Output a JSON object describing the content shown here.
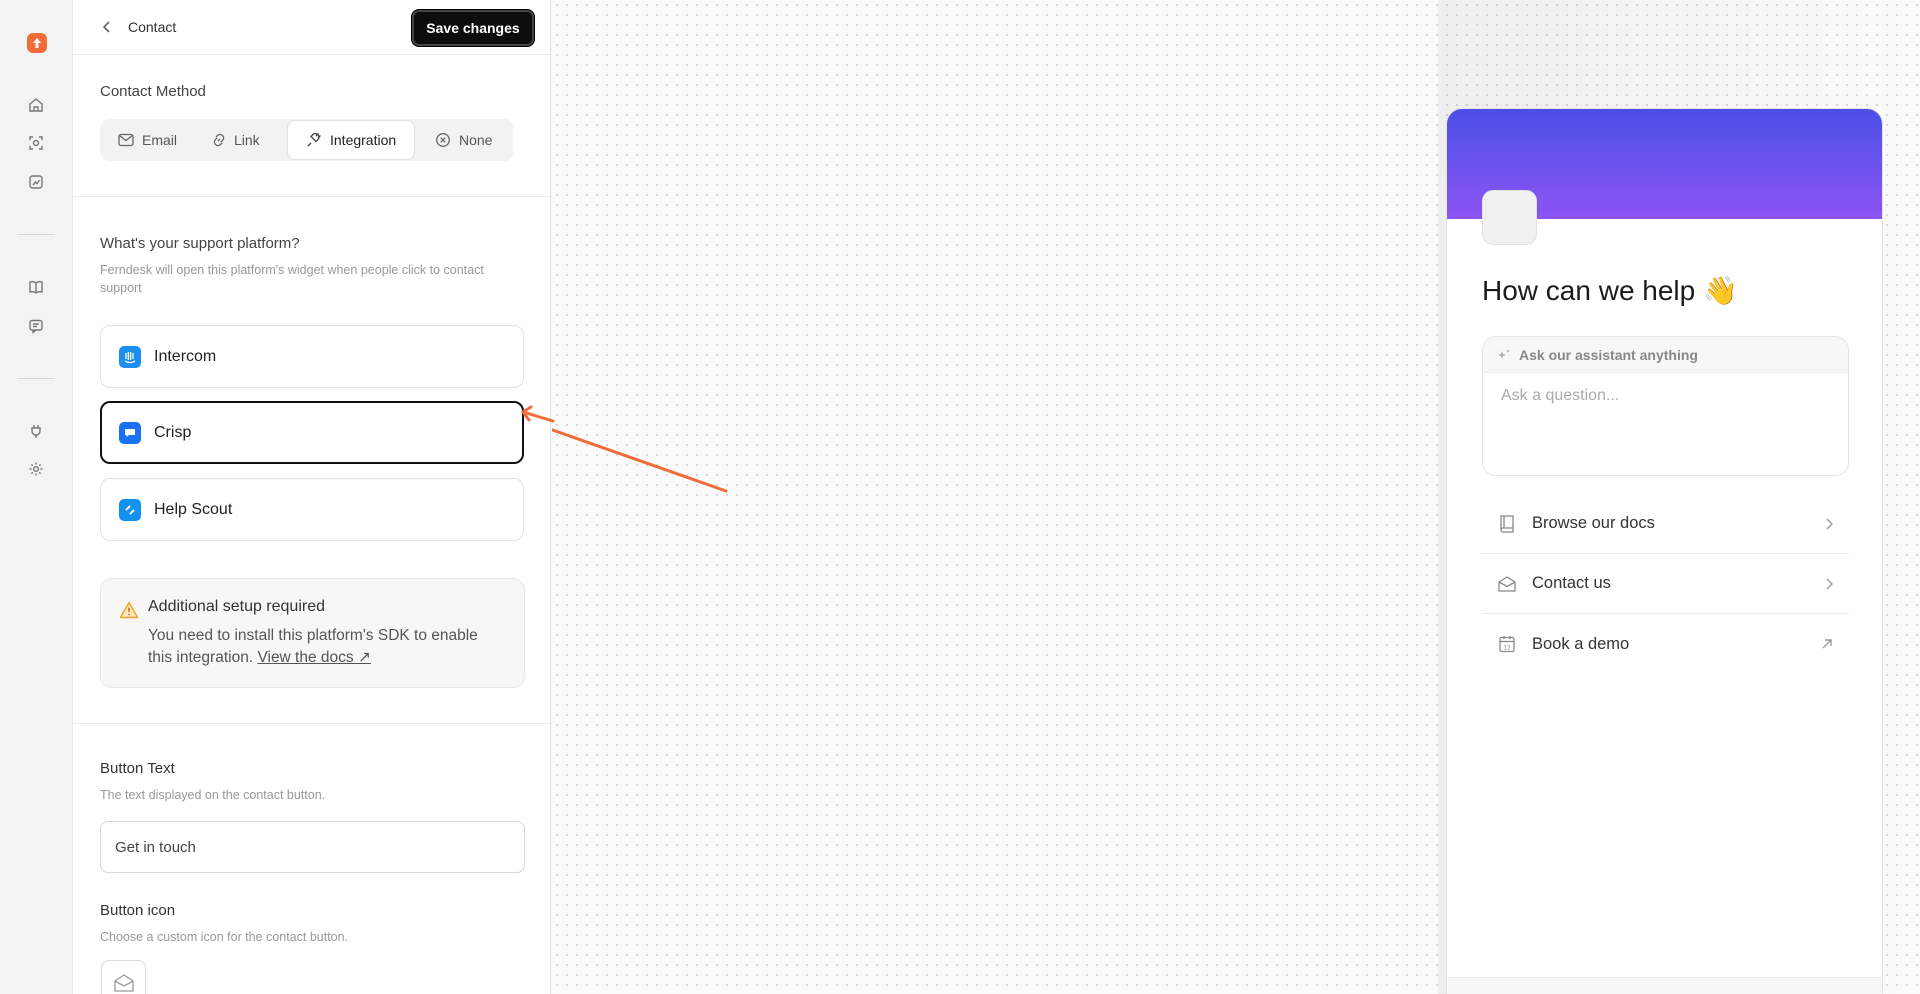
{
  "topbar": {
    "title": "Contact",
    "save_label": "Save changes"
  },
  "contact_method": {
    "label": "Contact Method",
    "options": [
      "Email",
      "Link",
      "Integration",
      "None"
    ],
    "selected": "Integration"
  },
  "platform": {
    "question": "What's your support platform?",
    "help": "Ferndesk will open this platform's widget when people click to contact support",
    "options": [
      {
        "name": "Intercom",
        "color": "#1f8ded"
      },
      {
        "name": "Crisp",
        "color": "#1972f5"
      },
      {
        "name": "Help Scout",
        "color": "#1292ee"
      }
    ],
    "selected": "Crisp"
  },
  "notice": {
    "title": "Additional setup required",
    "body": "You need to install this platform's SDK to enable this integration.",
    "link": "View the docs ↗",
    "icon_color": "#f0a52b"
  },
  "button_text": {
    "label": "Button Text",
    "help": "The text displayed on the contact button.",
    "value": "Get in touch"
  },
  "button_icon": {
    "label": "Button icon",
    "help": "Choose a custom icon for the contact button."
  },
  "widget": {
    "title": "How can we help 👋",
    "assistant_label": "Ask our assistant anything",
    "assistant_placeholder": "Ask a question...",
    "links": [
      {
        "label": "Browse our docs",
        "icon": "book-icon",
        "action": "chevron-right-icon"
      },
      {
        "label": "Contact us",
        "icon": "envelope-icon",
        "action": "chevron-right-icon"
      },
      {
        "label": "Book a demo",
        "icon": "calendar-icon",
        "action": "external-arrow-icon"
      }
    ],
    "banner_colors": [
      "#4b4fe8",
      "#8d55f2"
    ]
  },
  "accent": "#f26b3a"
}
